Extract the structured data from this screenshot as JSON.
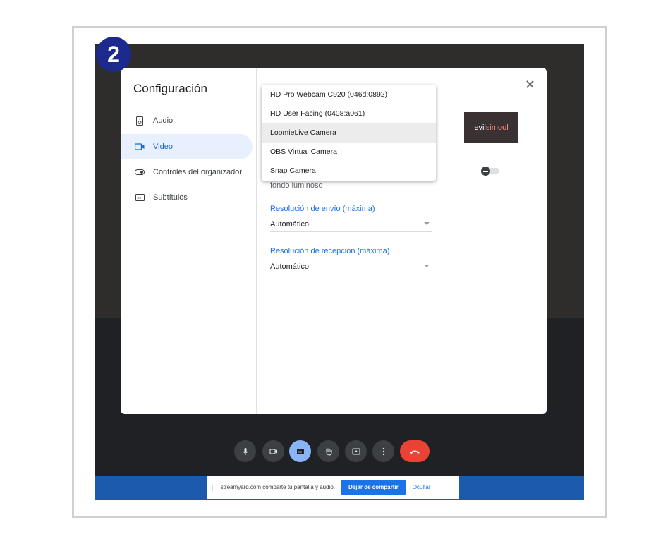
{
  "step_number": "2",
  "dialog": {
    "title": "Configuración",
    "close_symbol": "✕",
    "nav": [
      {
        "label": "Audio",
        "icon": "speaker-icon"
      },
      {
        "label": "Video",
        "icon": "video-camera-icon",
        "active": true
      },
      {
        "label": "Controles del organizador",
        "icon": "toggle-icon"
      },
      {
        "label": "Subtítulos",
        "icon": "captions-icon"
      }
    ],
    "preview_thumbnail_text_a": "evil",
    "preview_thumbnail_text_b": "simool",
    "lighting_text_fragment": "fondo luminoso",
    "send_resolution": {
      "label": "Resolución de envío (máxima)",
      "value": "Automático"
    },
    "receive_resolution": {
      "label": "Resolución de recepción (máxima)",
      "value": "Automático"
    }
  },
  "camera_dropdown": {
    "options": [
      "HD Pro Webcam C920 (046d:0892)",
      "HD User Facing (0408:a061)",
      "LoomieLive Camera",
      "OBS Virtual Camera",
      "Snap Camera"
    ],
    "highlighted_index": 2
  },
  "share_bar": {
    "message": "streamyard.com comparte tu pantalla y audio.",
    "stop_label": "Dejar de compartir",
    "hide_label": "Ocultar"
  },
  "colors": {
    "accent": "#1a73e8",
    "badge": "#1b2a8c",
    "end_call": "#ea4335",
    "share_bar": "#1b5aad"
  }
}
